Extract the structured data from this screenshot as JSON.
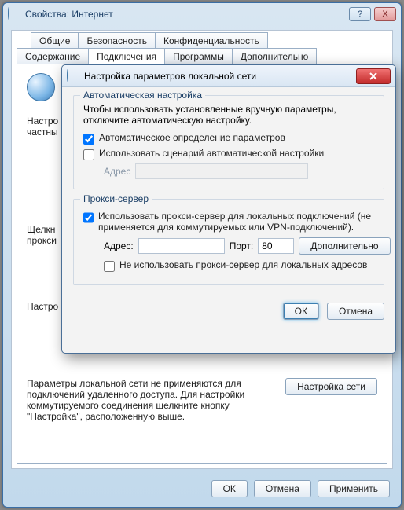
{
  "main": {
    "title": "Свойства: Интернет",
    "help": "?",
    "close": "X",
    "tabs_row1": [
      "Общие",
      "Безопасность",
      "Конфиденциальность"
    ],
    "tabs_row2": [
      "Содержание",
      "Подключения",
      "Программы",
      "Дополнительно"
    ],
    "active_tab": "Подключения",
    "partial1": "Настро",
    "partial2": "частны",
    "partial3": "Щелкн",
    "partial4": "прокси",
    "partial5": "Настро",
    "lan_group_legend": "",
    "lan_text": "Параметры локальной сети не применяются для подключений удаленного доступа. Для настройки коммутируемого соединения щелкните кнопку \"Настройка\", расположенную выше.",
    "lan_settings_btn": "Настройка сети",
    "footer": {
      "ok": "ОК",
      "cancel": "Отмена",
      "apply": "Применить"
    }
  },
  "lan": {
    "title": "Настройка параметров локальной сети",
    "auto": {
      "legend": "Автоматическая настройка",
      "desc": "Чтобы использовать установленные вручную параметры, отключите автоматическую настройку.",
      "detect": "Автоматическое определение параметров",
      "detect_checked": true,
      "script": "Использовать сценарий автоматической настройки",
      "script_checked": false,
      "addr_label": "Адрес",
      "addr_value": ""
    },
    "proxy": {
      "legend": "Прокси-сервер",
      "use": "Использовать прокси-сервер для локальных подключений (не применяется для коммутируемых или VPN-подключений).",
      "use_checked": true,
      "addr_label": "Адрес:",
      "addr_value": "",
      "port_label": "Порт:",
      "port_value": "80",
      "advanced": "Дополнительно",
      "bypass": "Не использовать прокси-сервер для локальных адресов",
      "bypass_checked": false
    },
    "footer": {
      "ok": "ОК",
      "cancel": "Отмена"
    }
  }
}
